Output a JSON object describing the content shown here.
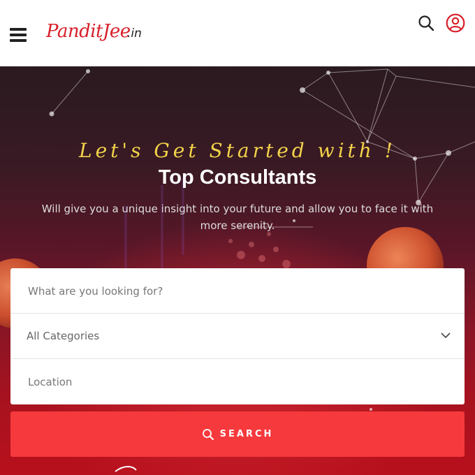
{
  "header": {
    "logo": {
      "name": "PanditJee",
      "tld": ".in"
    },
    "icons": {
      "menu": "menu-icon",
      "search": "search-icon",
      "account": "user-icon"
    }
  },
  "hero": {
    "tagline": "Let's Get Started with !",
    "title": "Top Consultants",
    "subtitle": "Will give you a unique insight into your future and allow you to face it with more serenity."
  },
  "search_form": {
    "keyword_placeholder": "What are you looking for?",
    "category_value": "All Categories",
    "location_placeholder": "Location",
    "search_label": "SEARCH"
  },
  "colors": {
    "brand_red": "#d8202a",
    "button_red": "#f5393c",
    "tagline_gold": "#f3d34a"
  }
}
